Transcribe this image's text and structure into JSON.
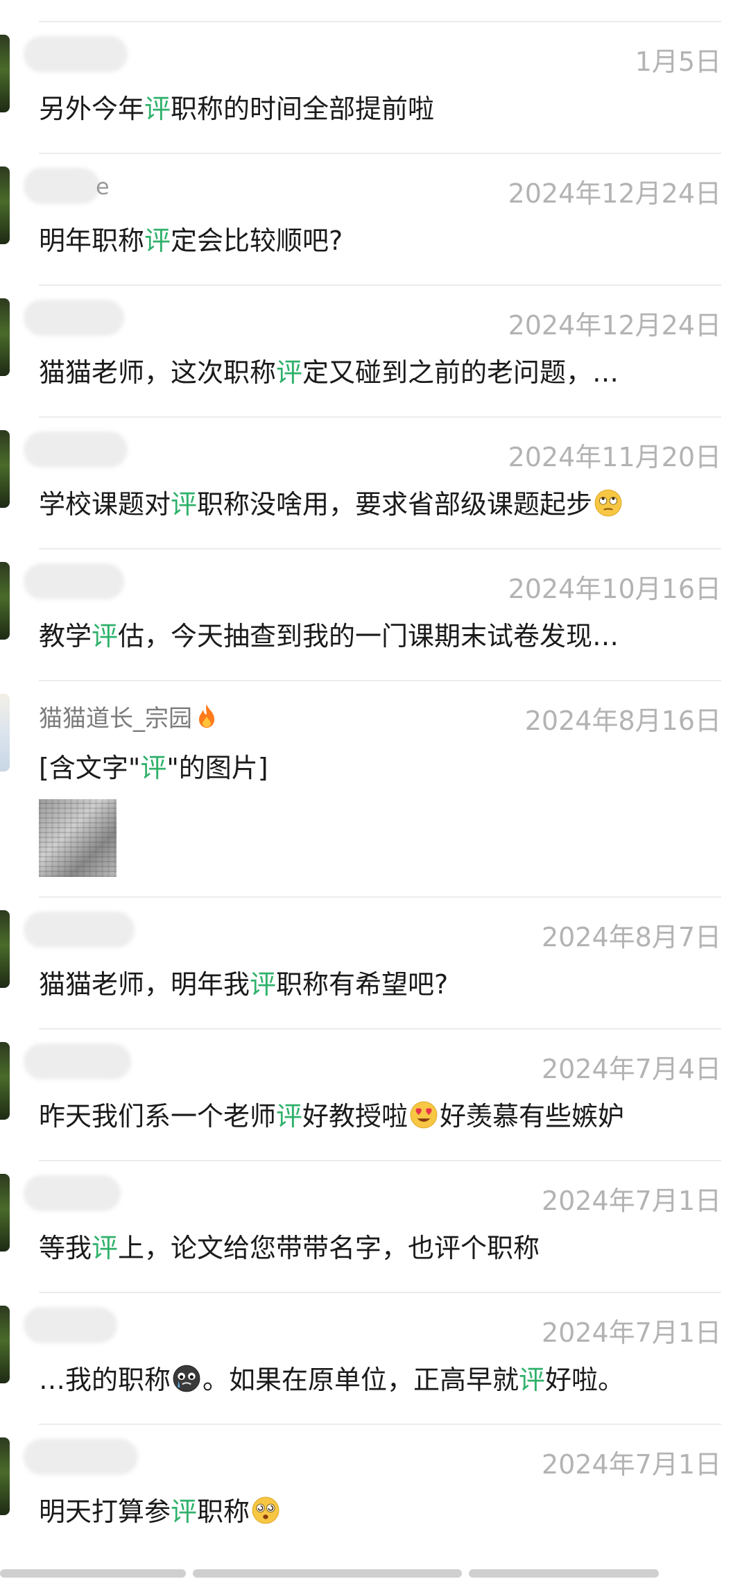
{
  "results": [
    {
      "name_tail": "",
      "date": "1月5日",
      "message": [
        "另外今年",
        "评",
        "职称的时间全部提前啦"
      ],
      "emoji": null
    },
    {
      "name_tail": "e",
      "date": "2024年12月24日",
      "message": [
        "明年职称",
        "评",
        "定会比较顺吧?"
      ],
      "emoji": null
    },
    {
      "name_tail": "",
      "date": "2024年12月24日",
      "message": [
        "猫猫老师，这次职称",
        "评",
        "定又碰到之前的老问题，…"
      ],
      "emoji": null
    },
    {
      "name_tail": "",
      "date": "2024年11月20日",
      "message": [
        "学校课题对",
        "评",
        "职称没啥用，要求省部级课题起步"
      ],
      "emoji": "rolling-eyes-emoji-icon"
    },
    {
      "name_tail": "",
      "date": "2024年10月16日",
      "message": [
        "教学",
        "评",
        "估，今天抽查到我的一门课期末试卷发现…"
      ],
      "emoji": null
    },
    {
      "name": "猫猫道长_宗园",
      "date": "2024年8月16日",
      "message": [
        "[含文字\"",
        "评",
        "\"的图片]"
      ],
      "emoji": null,
      "has_image": true
    },
    {
      "name_tail": "",
      "date": "2024年8月7日",
      "message": [
        "猫猫老师，明年我",
        "评",
        "职称有希望吧?"
      ],
      "emoji": null
    },
    {
      "name_tail": "",
      "date": "2024年7月4日",
      "message": [
        "昨天我们系一个老师",
        "评",
        "好教授啦",
        "好羡慕有些嫉妒"
      ],
      "emoji": "heart-eyes-emoji-icon"
    },
    {
      "name_tail": "",
      "date": "2024年7月1日",
      "message": [
        "等我",
        "评",
        "上，论文给您带带名字，也评个职称"
      ],
      "emoji": null
    },
    {
      "name_tail": "",
      "date": "2024年7月1日",
      "message": [
        "…我的职称",
        "。如果在原单位，正高早就",
        "评",
        "好啦。"
      ],
      "emoji": "crying-face-emoji-icon"
    },
    {
      "name_tail": "",
      "date": "2024年7月1日",
      "message": [
        "明天打算参",
        "评",
        "职称"
      ],
      "emoji": "dizzy-face-emoji-icon"
    }
  ],
  "colors": {
    "keyword": "#2fb16a",
    "date": "#b3b3b3",
    "text": "#1a1a1a",
    "divider": "#ececec"
  }
}
